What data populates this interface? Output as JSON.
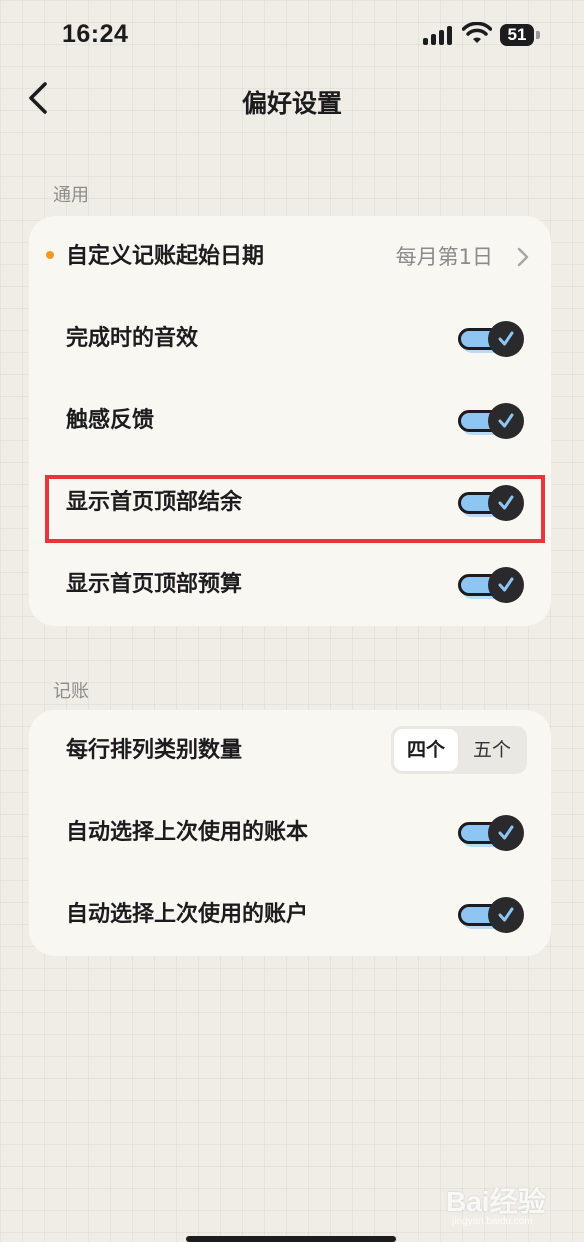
{
  "status_bar": {
    "time": "16:24",
    "battery": "51"
  },
  "nav": {
    "back_icon": "chevron-left-icon",
    "title": "偏好设置"
  },
  "sections": {
    "general": {
      "label": "通用",
      "rows": {
        "start_date": {
          "label": "自定义记账起始日期",
          "value": "每月第1日",
          "dot_color": "#f39a1e"
        },
        "sound": {
          "label": "完成时的音效",
          "toggle_on": true
        },
        "haptic": {
          "label": "触感反馈",
          "toggle_on": true
        },
        "show_balance": {
          "label": "显示首页顶部结余",
          "toggle_on": true,
          "highlighted": true
        },
        "show_budget": {
          "label": "显示首页顶部预算",
          "toggle_on": true
        }
      }
    },
    "bookkeeping": {
      "label": "记账",
      "rows": {
        "category_count": {
          "label": "每行排列类别数量",
          "options": [
            "四个",
            "五个"
          ],
          "selected": "四个"
        },
        "auto_ledger": {
          "label": "自动选择上次使用的账本",
          "toggle_on": true
        },
        "auto_account": {
          "label": "自动选择上次使用的账户",
          "toggle_on": true
        }
      }
    }
  },
  "watermark": {
    "text": "Bai经验",
    "sub": "jingyan.baidu.com"
  },
  "colors": {
    "background": "#efede6",
    "card": "#f8f7f2",
    "toggle_track": "#8ec5f3",
    "toggle_knob": "#2a2a2c",
    "check": "#8ec5f3",
    "highlight": "#e8343c",
    "accent_dot": "#f39a1e"
  }
}
